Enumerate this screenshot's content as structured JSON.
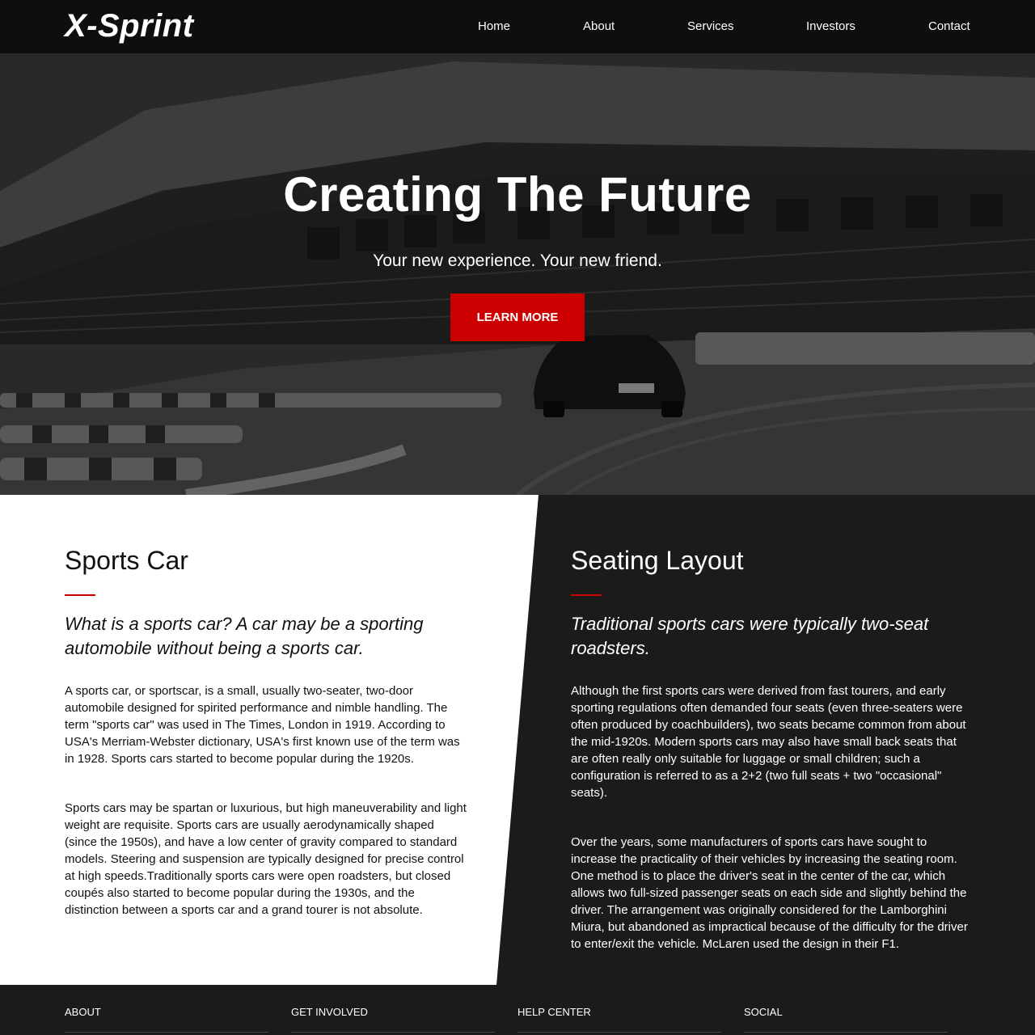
{
  "brand": {
    "logo": "X-Sprint"
  },
  "nav": {
    "items": [
      "Home",
      "About",
      "Services",
      "Investors",
      "Contact"
    ]
  },
  "hero": {
    "title": "Creating The Future",
    "subtitle": "Your new experience. Your new friend.",
    "cta_label": "LEARN MORE"
  },
  "sections": {
    "left": {
      "heading": "Sports Car",
      "lead": "What is a sports car? A car may be a sporting automobile without being a sports car.",
      "para1": "A sports car, or sportscar, is a small, usually two-seater, two-door automobile designed for spirited performance and nimble handling. The term \"sports car\" was used in The Times, London in 1919. According to USA's Merriam-Webster dictionary, USA's first known use of the term was in 1928. Sports cars started to become popular during the 1920s.",
      "para2": "Sports cars may be spartan or luxurious, but high maneuverability and light weight are requisite. Sports cars are usually aerodynamically shaped (since the 1950s), and have a low center of gravity compared to standard models. Steering and suspension are typically designed for precise control at high speeds.Traditionally sports cars were open roadsters, but closed coupés also started to become popular during the 1930s, and the distinction between a sports car and a grand tourer is not absolute."
    },
    "right": {
      "heading": "Seating Layout",
      "lead": "Traditional sports cars were typically two-seat roadsters.",
      "para1": "Although the first sports cars were derived from fast tourers, and early sporting regulations often demanded four seats (even three-seaters were often produced by coachbuilders), two seats became common from about the mid-1920s. Modern sports cars may also have small back seats that are often really only suitable for luggage or small children; such a configuration is referred to as a 2+2 (two full seats + two \"occasional\" seats).",
      "para2": "Over the years, some manufacturers of sports cars have sought to increase the practicality of their vehicles by increasing the seating room. One method is to place the driver's seat in the center of the car, which allows two full-sized passenger seats on each side and slightly behind the driver. The arrangement was originally considered for the Lamborghini Miura, but abandoned as impractical because of the difficulty for the driver to enter/exit the vehicle. McLaren used the design in their F1."
    }
  },
  "footer": {
    "columns": [
      "ABOUT",
      "GET INVOLVED",
      "HELP CENTER",
      "SOCIAL"
    ]
  },
  "colors": {
    "accent": "#cc0000",
    "dark": "#1b1b1c",
    "header": "#0e0e0e"
  }
}
